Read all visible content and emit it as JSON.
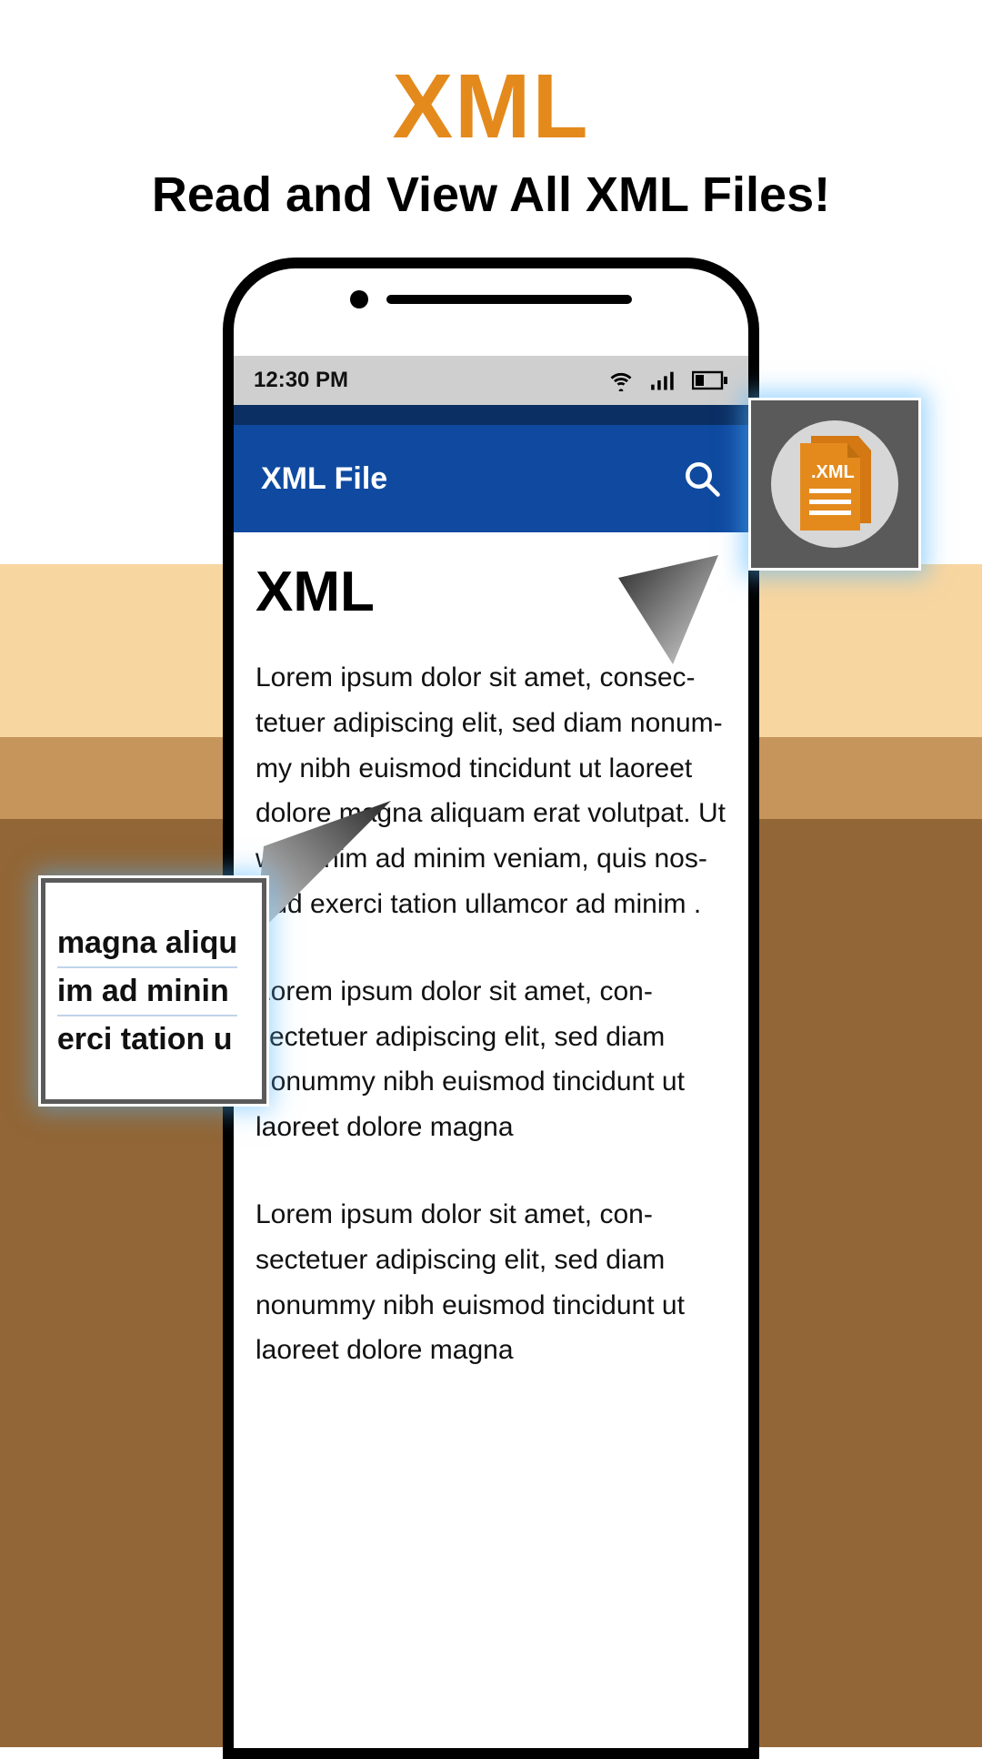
{
  "hero": {
    "title": "XML",
    "subtitle": "Read and View All XML Files!"
  },
  "statusbar": {
    "time": "12:30 PM"
  },
  "appbar": {
    "title": "XML File"
  },
  "document": {
    "heading": "XML",
    "paragraphs": [
      "Lorem ipsum dolor sit amet, consec-tetuer adipiscing elit, sed diam nonum-my nibh euismod tincidunt ut laoreet dolore magna aliquam erat volutpat. Ut wisi enim ad minim veniam, quis nos-trud exerci tation ullamcor ad minim .",
      "Lorem ipsum dolor sit amet, con-sectetuer adipiscing elit, sed diam nonummy nibh euismod tincidunt ut laoreet dolore magna",
      "Lorem ipsum dolor sit amet, con-sectetuer adipiscing elit, sed diam nonummy nibh euismod tincidunt ut laoreet dolore magna"
    ]
  },
  "callouts": {
    "xml_badge": ".XML",
    "zoom_lines": [
      "magna aliqu",
      "im ad minin",
      "erci tation u"
    ]
  }
}
